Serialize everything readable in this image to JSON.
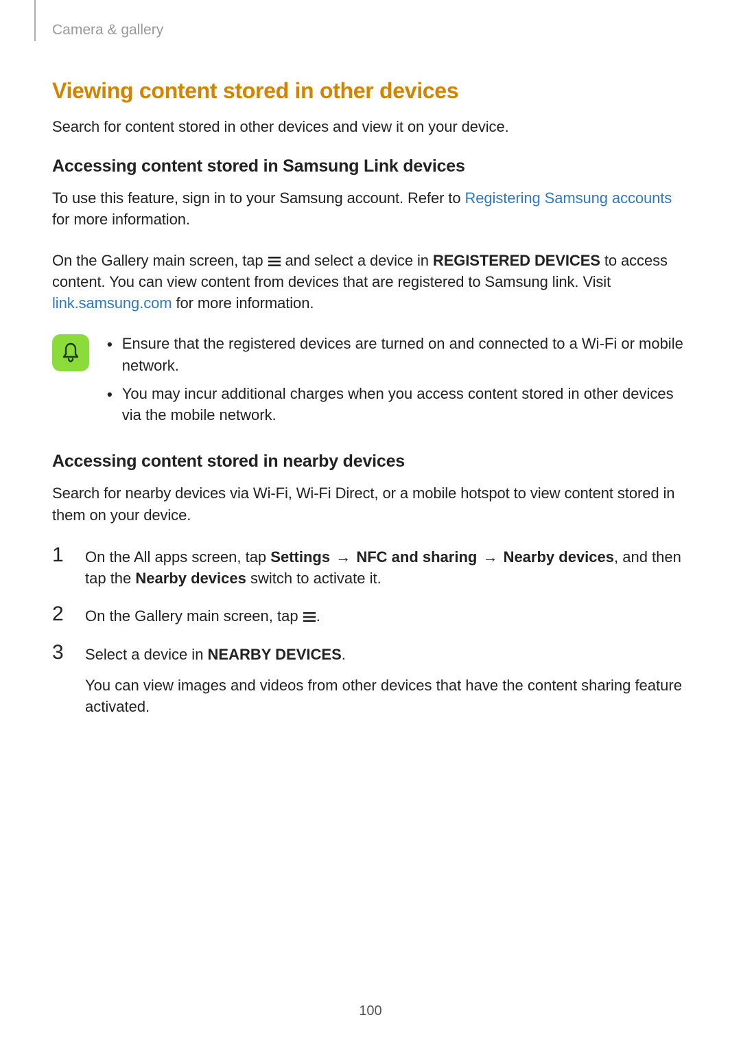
{
  "breadcrumb": "Camera & gallery",
  "h2": "Viewing content stored in other devices",
  "intro": "Search for content stored in other devices and view it on your device.",
  "section1": {
    "title": "Accessing content stored in Samsung Link devices",
    "p1_a": "To use this feature, sign in to your Samsung account. Refer to ",
    "p1_link": "Registering Samsung accounts",
    "p1_b": " for more information.",
    "p2_a": "On the Gallery main screen, tap ",
    "p2_b": " and select a device in ",
    "p2_bold": "REGISTERED DEVICES",
    "p2_c": " to access content. You can view content from devices that are registered to Samsung link. Visit ",
    "p2_link": "link.samsung.com",
    "p2_d": " for more information.",
    "note1": "Ensure that the registered devices are turned on and connected to a Wi-Fi or mobile network.",
    "note2": "You may incur additional charges when you access content stored in other devices via the mobile network."
  },
  "section2": {
    "title": "Accessing content stored in nearby devices",
    "intro": "Search for nearby devices via Wi-Fi, Wi-Fi Direct, or a mobile hotspot to view content stored in them on your device.",
    "step1_a": "On the All apps screen, tap ",
    "step1_b1": "Settings",
    "step1_arrow": " → ",
    "step1_b2": "NFC and sharing",
    "step1_b3": "Nearby devices",
    "step1_c": ", and then tap the ",
    "step1_b4": "Nearby devices",
    "step1_d": " switch to activate it.",
    "step2_a": "On the Gallery main screen, tap ",
    "step2_b": ".",
    "step3_a": "Select a device in ",
    "step3_bold": "NEARBY DEVICES",
    "step3_b": ".",
    "step3_sub": "You can view images and videos from other devices that have the content sharing feature activated."
  },
  "markers": {
    "n1": "1",
    "n2": "2",
    "n3": "3"
  },
  "bullet": "•",
  "pageNumber": "100"
}
